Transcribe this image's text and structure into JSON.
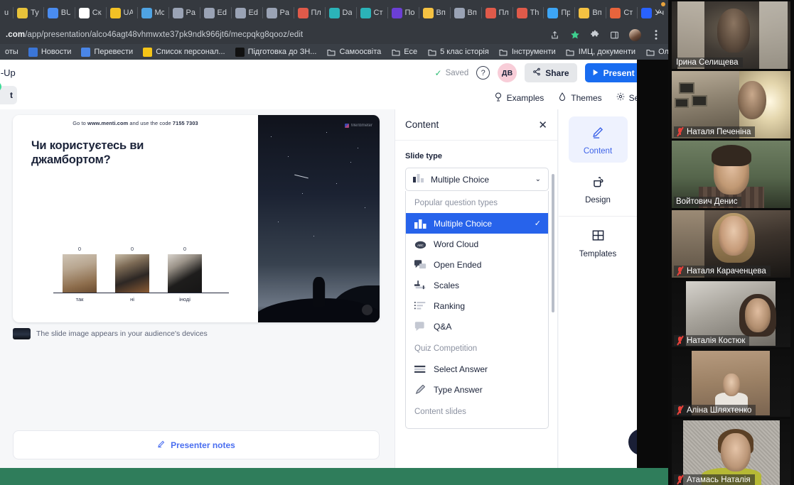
{
  "browser": {
    "tabs": [
      {
        "label": "u",
        "color": "#35393f"
      },
      {
        "label": "Ty",
        "color": "#e8c33a"
      },
      {
        "label": "BU",
        "color": "#4a8cf0"
      },
      {
        "label": "Ск",
        "color": "#ffffff"
      },
      {
        "label": "UA",
        "color": "#f2c125"
      },
      {
        "label": "Mc",
        "color": "#4fa3e3"
      },
      {
        "label": "Pa",
        "color": "#9aa3b5"
      },
      {
        "label": "Ed",
        "color": "#9aa3b5"
      },
      {
        "label": "Ed",
        "color": "#9aa3b5"
      },
      {
        "label": "Pa",
        "color": "#9aa3b5"
      },
      {
        "label": "Пл",
        "color": "#e05a4a"
      },
      {
        "label": "Da",
        "color": "#2bb3b8"
      },
      {
        "label": "Ст",
        "color": "#2bb3b8"
      },
      {
        "label": "По",
        "color": "#6b3fd4"
      },
      {
        "label": "Вп",
        "color": "#f5c242"
      },
      {
        "label": "Вп",
        "color": "#9aa3b5"
      },
      {
        "label": "Пл",
        "color": "#e05a4a"
      },
      {
        "label": "Th",
        "color": "#e05a4a"
      },
      {
        "label": "Пр",
        "color": "#3da5f5"
      },
      {
        "label": "Вп",
        "color": "#f5c242"
      },
      {
        "label": "Ст",
        "color": "#e8643c"
      },
      {
        "label": "Уч",
        "color": "#2962ff"
      }
    ],
    "new_tab_label": "+",
    "url_host": ".com",
    "url_path": "/app/presentation/alco46agt48vhmwxte37pk9ndk966jt6/mecpqkg8qooz/edit",
    "omni_icons": [
      "share-icon",
      "bookmark-star-icon",
      "extensions-icon",
      "sidepanel-icon",
      "profile-avatar",
      "kebab-menu-icon"
    ],
    "bookmarks": [
      {
        "label": "оты",
        "kind": "plain"
      },
      {
        "label": "Новости",
        "kind": "news"
      },
      {
        "label": "Перевести",
        "kind": "translate"
      },
      {
        "label": "Список персонал...",
        "kind": "sheet"
      },
      {
        "label": "Підготовка до ЗН...",
        "kind": "dark"
      },
      {
        "label": "Самоосвіта",
        "kind": "folder"
      },
      {
        "label": "Есе",
        "kind": "folder"
      },
      {
        "label": "5 клас історія",
        "kind": "folder"
      },
      {
        "label": "Інструменти",
        "kind": "folder"
      },
      {
        "label": "ІМЦ, документи",
        "kind": "folder"
      },
      {
        "label": "Олімпіада",
        "kind": "folder"
      }
    ],
    "bookmarks_overflow": "»"
  },
  "app": {
    "doc_title": "m-Up",
    "saved_label": "Saved",
    "help_label": "?",
    "user_initials": "ДВ",
    "share_label": "Share",
    "present_label": "Present",
    "present_caret": "⌄",
    "left_tab_label": "t",
    "subnav": [
      {
        "label": "Examples",
        "icon": "bulb-icon"
      },
      {
        "label": "Themes",
        "icon": "droplet-icon"
      },
      {
        "label": "Settings",
        "icon": "gear-icon"
      }
    ]
  },
  "slide": {
    "code_prefix": "Go to ",
    "code_site": "www.menti.com",
    "code_middle": " and use the code ",
    "code_value": "7155 7303",
    "question": "Чи користуєтесь ви джамбортом?",
    "caption": "The slide image appears in your audience's devices",
    "presenter_notes_label": "Presenter notes",
    "watermark": "Mentimeter"
  },
  "chart_data": {
    "type": "bar",
    "title": "Чи користуєтесь ви джамбортом?",
    "categories": [
      "так",
      "ні",
      "іноді"
    ],
    "values": [
      0,
      0,
      0
    ],
    "xlabel": "",
    "ylabel": "",
    "ylim": [
      0,
      0
    ],
    "grid": false,
    "legend": "none",
    "note": "Each bar is rendered as a cat photo option image with a count label above it"
  },
  "content_panel": {
    "title": "Content",
    "close_label": "✕",
    "slide_type_label": "Slide type",
    "selected": "Multiple Choice",
    "caret": "⌄",
    "groups": [
      {
        "group": "Popular question types",
        "items": [
          {
            "label": "Multiple Choice",
            "icon": "bar-chart-icon",
            "selected": true
          },
          {
            "label": "Word Cloud",
            "icon": "word-cloud-icon",
            "selected": false
          },
          {
            "label": "Open Ended",
            "icon": "speech-bubbles-icon",
            "selected": false
          },
          {
            "label": "Scales",
            "icon": "scales-icon",
            "selected": false
          },
          {
            "label": "Ranking",
            "icon": "ranking-icon",
            "selected": false
          },
          {
            "label": "Q&A",
            "icon": "qa-bubble-icon",
            "selected": false
          }
        ]
      },
      {
        "group": "Quiz Competition",
        "items": [
          {
            "label": "Select Answer",
            "icon": "select-answer-icon",
            "selected": false
          },
          {
            "label": "Type Answer",
            "icon": "pencil-icon",
            "selected": false
          }
        ]
      },
      {
        "group": "Content slides",
        "items": []
      }
    ],
    "check_glyph": "✓"
  },
  "rail": {
    "items": [
      {
        "label": "Content",
        "icon": "pencil-icon",
        "active": true
      },
      {
        "label": "Design",
        "icon": "paint-bucket-icon",
        "active": false
      },
      {
        "label": "Templates",
        "icon": "grid-icon",
        "active": false
      }
    ]
  },
  "chat": {
    "icon": "chat-bubble-icon"
  },
  "video_panel": {
    "participants": [
      {
        "name": "Ірина Селищева",
        "muted": false,
        "speaking": false,
        "style": "ph1"
      },
      {
        "name": "Наталя Печеніна",
        "muted": true,
        "speaking": false,
        "style": "ph2"
      },
      {
        "name": "Войтович Денис",
        "muted": false,
        "speaking": true,
        "style": "ph3"
      },
      {
        "name": "Наталя Караченцева",
        "muted": true,
        "speaking": false,
        "style": "ph4"
      },
      {
        "name": "Наталія Костюк",
        "muted": true,
        "speaking": false,
        "style": "ph5"
      },
      {
        "name": "Аліна Шляхтенко",
        "muted": true,
        "speaking": false,
        "style": "ph6"
      },
      {
        "name": "Атамась Наталія",
        "muted": true,
        "speaking": false,
        "style": "ph7"
      }
    ]
  },
  "colors": {
    "accent_blue": "#2763eb",
    "present_blue": "#196cf0",
    "speaking_outline": "#d9e53c",
    "saved_green": "#2ebd75",
    "chrome_bg": "#35393f",
    "notes_blue": "#4a6ef0"
  }
}
